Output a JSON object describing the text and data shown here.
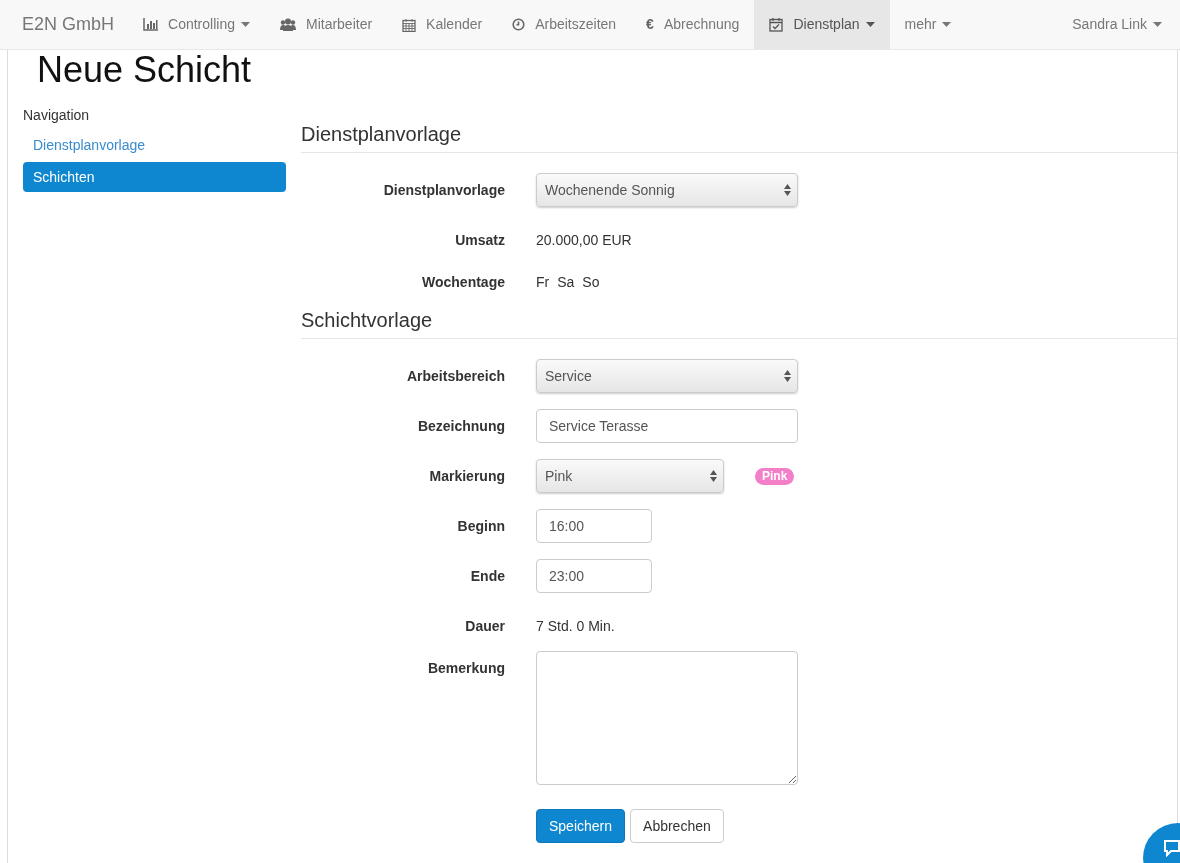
{
  "navbar": {
    "brand": "E2N GmbH",
    "items": [
      {
        "label": "Controlling",
        "dropdown": true,
        "selected": false
      },
      {
        "label": "Mitarbeiter",
        "dropdown": false,
        "selected": false
      },
      {
        "label": "Kalender",
        "dropdown": false,
        "selected": false
      },
      {
        "label": "Arbeitszeiten",
        "dropdown": false,
        "selected": false
      },
      {
        "label": "Abrechnung",
        "icon_text": "€",
        "dropdown": false,
        "selected": false
      },
      {
        "label": "Dienstplan",
        "dropdown": true,
        "selected": true
      },
      {
        "label": "mehr",
        "dropdown": true,
        "selected": false
      }
    ],
    "user": {
      "label": "Sandra Link",
      "dropdown": true
    }
  },
  "page_title": "Neue Schicht",
  "sidebar": {
    "heading": "Navigation",
    "items": [
      {
        "label": "Dienstplanvorlage",
        "selected": false
      },
      {
        "label": "Schichten",
        "selected": true
      }
    ]
  },
  "sections": [
    {
      "title": "Dienstplanvorlage",
      "fields": [
        {
          "kind": "select",
          "label": "Dienstplanvorlage",
          "value": "Wochenende Sonnig"
        },
        {
          "kind": "static",
          "label": "Umsatz",
          "value": "20.000,00 EUR"
        },
        {
          "kind": "days",
          "label": "Wochentage",
          "values": [
            "Fr",
            "Sa",
            "So"
          ]
        }
      ]
    },
    {
      "title": "Schichtvorlage",
      "fields": [
        {
          "kind": "select",
          "label": "Arbeitsbereich",
          "value": "Service"
        },
        {
          "kind": "input",
          "label": "Bezeichnung",
          "value": "Service Terasse"
        },
        {
          "kind": "color_select",
          "label": "Markierung",
          "value": "Pink",
          "badge": "Pink",
          "color": "#f27fc8"
        },
        {
          "kind": "time",
          "label": "Beginn",
          "value": "16:00"
        },
        {
          "kind": "time",
          "label": "Ende",
          "value": "23:00"
        },
        {
          "kind": "static",
          "label": "Dauer",
          "value": "7 Std. 0 Min."
        },
        {
          "kind": "textarea",
          "label": "Bemerkung"
        }
      ]
    }
  ],
  "buttons": [
    {
      "label": "Speichern",
      "kind": "primary"
    },
    {
      "label": "Abbrechen",
      "kind": "default"
    }
  ]
}
